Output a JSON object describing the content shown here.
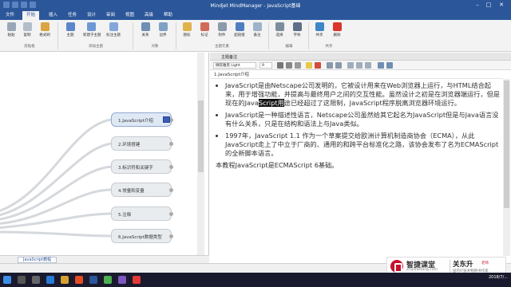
{
  "window": {
    "title": "Mindjet MindManager - JavaScript基础"
  },
  "ribbon": {
    "tabs": [
      {
        "label": "文件"
      },
      {
        "label": "开始"
      },
      {
        "label": "插入"
      },
      {
        "label": "任务"
      },
      {
        "label": "设计"
      },
      {
        "label": "审阅"
      },
      {
        "label": "视图"
      },
      {
        "label": "高级"
      },
      {
        "label": "帮助"
      }
    ],
    "active_tab": "开始",
    "buttons": [
      {
        "label": "粘贴"
      },
      {
        "label": "复制"
      },
      {
        "label": "格式刷"
      },
      {
        "label": "主题"
      },
      {
        "label": "新建子主题"
      },
      {
        "label": "标注主题"
      },
      {
        "label": "关系"
      },
      {
        "label": "边界"
      },
      {
        "label": "图标"
      },
      {
        "label": "标记"
      },
      {
        "label": "附件"
      },
      {
        "label": "超链接"
      },
      {
        "label": "备注"
      },
      {
        "label": "选择"
      },
      {
        "label": "字体"
      },
      {
        "label": "共享"
      },
      {
        "label": "删除"
      }
    ],
    "groups": [
      {
        "label": "剪贴板"
      },
      {
        "label": "添加主题"
      },
      {
        "label": "对象"
      },
      {
        "label": "主题元素"
      },
      {
        "label": "编辑"
      },
      {
        "label": "共享"
      }
    ]
  },
  "map": {
    "topics": [
      {
        "label": "1.JavaScript介绍",
        "selected": true
      },
      {
        "label": "2.环境搭建"
      },
      {
        "label": "3.标识符和关键字"
      },
      {
        "label": "4.常量和变量"
      },
      {
        "label": "5.注释"
      },
      {
        "label": "6.JavaScript数据类型"
      }
    ],
    "doc_tab": "JavaScript教程"
  },
  "notes": {
    "header": "主题备注",
    "font_name": "微软雅黑 Light",
    "font_size": "9",
    "topic_title": "1.JavaScript介绍",
    "bullets": [
      {
        "before": "JavaScript是由Netscape公司发明的，它被设计用来在Web浏览器上运行，与HTML结合起来，用于增强功能，并提高与最终用户之间的交互性能。虽然设计之初是在浏览器端运行，但是现在的Java",
        "highlight": "Script用",
        "after": "途已经超过了这限制，JavaScript程序脱离浏览器环境运行。"
      },
      {
        "text": "JavaScript是一种描述性语言，Netscape公司虽然给其它起名为JavaScript但是与Java语言没有什么关系，只是在结构和语法上与Java类似。"
      },
      {
        "text": "1997年，JavaScript 1.1 作为一个草案提交给欧洲计算机制造商协会（ECMA），从此JavaScript走上了中立于厂商的、通用的和跨平台标准化之路，该协会发布了名为ECMAScript 的全新脚本语言。"
      }
    ],
    "footer_line": "本教程JavaScript是ECMAScript 6基础。"
  },
  "watermark": {
    "brand_cn": "智捷课堂",
    "brand_en": "Zhijieketang.com",
    "teacher": "关东升",
    "teacher_tag": "老师",
    "teacher_sub": "国内IT技术畅销书作家"
  },
  "taskbar": {
    "date": "2018/7/..."
  },
  "colors": {
    "ribbon_blue": "#2b579a",
    "selection": "#111111",
    "brand_red": "#c8102e"
  }
}
